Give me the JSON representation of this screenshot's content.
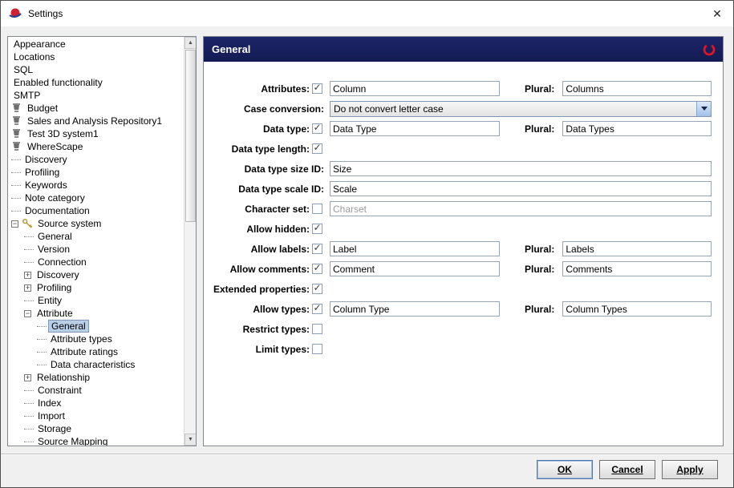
{
  "window": {
    "title": "Settings",
    "close": "✕"
  },
  "tree": {
    "items": [
      {
        "label": "Appearance",
        "level": 0
      },
      {
        "label": "Locations",
        "level": 0
      },
      {
        "label": "SQL",
        "level": 0
      },
      {
        "label": "Enabled functionality",
        "level": 0
      },
      {
        "label": "SMTP",
        "level": 0
      },
      {
        "label": "Budget",
        "level": 0,
        "icon": "repository"
      },
      {
        "label": "Sales and Analysis Repository1",
        "level": 0,
        "icon": "repository"
      },
      {
        "label": "Test 3D system1",
        "level": 0,
        "icon": "repository"
      },
      {
        "label": "WhereScape",
        "level": 0,
        "icon": "repository"
      },
      {
        "label": "Discovery",
        "level": 0,
        "dash": true
      },
      {
        "label": "Profiling",
        "level": 0,
        "dash": true
      },
      {
        "label": "Keywords",
        "level": 0,
        "dash": true
      },
      {
        "label": "Note category",
        "level": 0,
        "dash": true
      },
      {
        "label": "Documentation",
        "level": 0,
        "dash": true
      },
      {
        "label": "Source system",
        "level": 0,
        "expander": "minus",
        "icon": "keys"
      },
      {
        "label": "General",
        "level": 1,
        "dash": true
      },
      {
        "label": "Version",
        "level": 1,
        "dash": true
      },
      {
        "label": "Connection",
        "level": 1,
        "dash": true
      },
      {
        "label": "Discovery",
        "level": 1,
        "expander": "plus"
      },
      {
        "label": "Profiling",
        "level": 1,
        "expander": "plus"
      },
      {
        "label": "Entity",
        "level": 1,
        "dash": true
      },
      {
        "label": "Attribute",
        "level": 1,
        "expander": "minus"
      },
      {
        "label": "General",
        "level": 2,
        "dash": true,
        "selected": true
      },
      {
        "label": "Attribute types",
        "level": 2,
        "dash": true
      },
      {
        "label": "Attribute ratings",
        "level": 2,
        "dash": true
      },
      {
        "label": "Data characteristics",
        "level": 2,
        "dash": true
      },
      {
        "label": "Relationship",
        "level": 1,
        "expander": "plus"
      },
      {
        "label": "Constraint",
        "level": 1,
        "dash": true
      },
      {
        "label": "Index",
        "level": 1,
        "dash": true
      },
      {
        "label": "Import",
        "level": 1,
        "dash": true
      },
      {
        "label": "Storage",
        "level": 1,
        "dash": true
      },
      {
        "label": "Source Mapping",
        "level": 1,
        "dash": true
      }
    ]
  },
  "panel": {
    "title": "General"
  },
  "form": {
    "plural_label": "Plural:",
    "rows": [
      {
        "label": "Attributes:",
        "checkbox": true,
        "checked": true,
        "value": "Column",
        "plural": "Columns"
      },
      {
        "label": "Case conversion:",
        "dropdown": true,
        "value": "Do not convert letter case"
      },
      {
        "label": "Data type:",
        "checkbox": true,
        "checked": true,
        "value": "Data Type",
        "plural": "Data Types"
      },
      {
        "label": "Data type length:",
        "checkbox": true,
        "checked": true
      },
      {
        "label": "Data type size ID:",
        "wide": true,
        "value": "Size"
      },
      {
        "label": "Data type scale ID:",
        "wide": true,
        "value": "Scale"
      },
      {
        "label": "Character set:",
        "checkbox": true,
        "checked": false,
        "wide": true,
        "value": "Charset",
        "disabled": true
      },
      {
        "label": "Allow hidden:",
        "checkbox": true,
        "checked": true
      },
      {
        "label": "Allow labels:",
        "checkbox": true,
        "checked": true,
        "value": "Label",
        "plural": "Labels"
      },
      {
        "label": "Allow comments:",
        "checkbox": true,
        "checked": true,
        "value": "Comment",
        "plural": "Comments"
      },
      {
        "label": "Extended properties:",
        "checkbox": true,
        "checked": true
      },
      {
        "label": "Allow types:",
        "checkbox": true,
        "checked": true,
        "value": "Column Type",
        "plural": "Column Types"
      },
      {
        "label": "Restrict types:",
        "checkbox": true,
        "checked": false
      },
      {
        "label": "Limit types:",
        "checkbox": true,
        "checked": false
      }
    ]
  },
  "footer": {
    "ok": "OK",
    "cancel": "Cancel",
    "apply": "Apply"
  },
  "colors": {
    "header_bg": "#1b2468",
    "selection_bg": "#b9cfe8",
    "checkbox_border": "#8ba0be",
    "accent_red": "#e01525"
  }
}
